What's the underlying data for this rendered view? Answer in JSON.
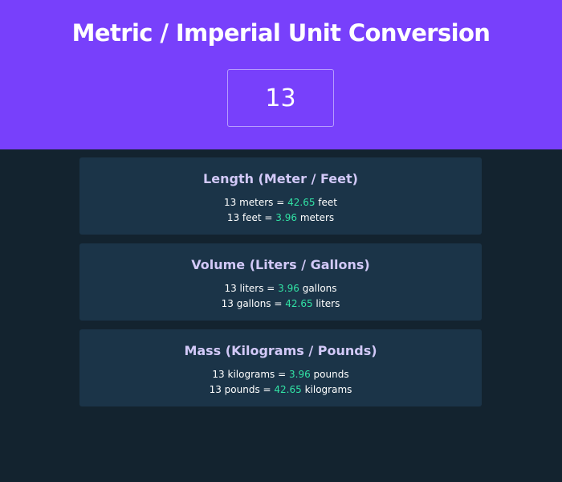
{
  "header": {
    "title": "Metric / Imperial Unit Conversion",
    "input_value": "13"
  },
  "colors": {
    "header_bg": "#7840fb",
    "page_bg": "#13232f",
    "card_bg": "#1b3448",
    "card_title": "#d2c9f8",
    "result": "#32e3a5"
  },
  "cards": [
    {
      "title": "Length (Meter / Feet)",
      "lines": [
        {
          "pre": "13 meters = ",
          "result": "42.65",
          "post": " feet"
        },
        {
          "pre": "13 feet = ",
          "result": "3.96",
          "post": " meters"
        }
      ]
    },
    {
      "title": "Volume (Liters / Gallons)",
      "lines": [
        {
          "pre": "13 liters = ",
          "result": "3.96",
          "post": " gallons"
        },
        {
          "pre": "13 gallons = ",
          "result": "42.65",
          "post": " liters"
        }
      ]
    },
    {
      "title": "Mass (Kilograms / Pounds)",
      "lines": [
        {
          "pre": "13 kilograms = ",
          "result": "3.96",
          "post": " pounds"
        },
        {
          "pre": "13 pounds = ",
          "result": "42.65",
          "post": " kilograms"
        }
      ]
    }
  ]
}
